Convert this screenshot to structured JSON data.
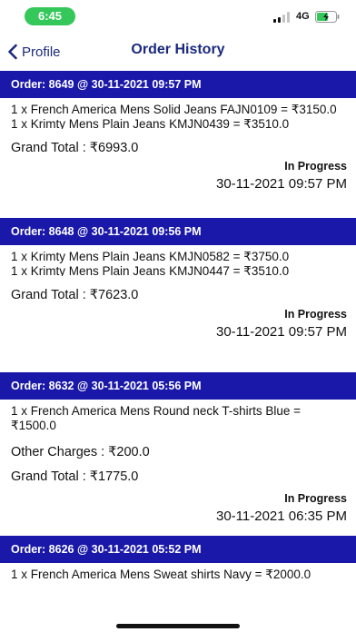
{
  "status_bar": {
    "time": "6:45",
    "network": "4G",
    "colors": {
      "time_pill": "#34c759"
    }
  },
  "nav": {
    "back_label": "Profile",
    "title": "Order History"
  },
  "colors": {
    "header_bg": "#1a18a8",
    "accent": "#1b2a7c"
  },
  "orders": [
    {
      "header": "Order: 8649 @ 30-11-2021 09:57 PM",
      "items": [
        "1 x French America Mens Solid Jeans FAJN0109 = ₹3150.0",
        "1 x Krimty Mens Plain Jeans KMJN0439 = ₹3510.0"
      ],
      "grand_total": "Grand Total : ₹6993.0",
      "status": "In Progress",
      "date": "30-11-2021 09:57 PM"
    },
    {
      "header": "Order: 8648 @ 30-11-2021 09:56 PM",
      "items": [
        "1 x Krimty Mens Plain Jeans KMJN0582 = ₹3750.0",
        "1 x Krimty Mens Plain Jeans KMJN0447 = ₹3510.0"
      ],
      "grand_total": "Grand Total : ₹7623.0",
      "status": "In Progress",
      "date": "30-11-2021 09:57 PM"
    },
    {
      "header": "Order: 8632 @ 30-11-2021 05:56 PM",
      "items": [
        "1 x French America Mens Round neck T-shirts Blue = ₹1500.0"
      ],
      "other_charges": "Other Charges : ₹200.0",
      "grand_total": "Grand Total : ₹1775.0",
      "status": "In Progress",
      "date": "30-11-2021 06:35 PM"
    },
    {
      "header": "Order: 8626 @ 30-11-2021 05:52 PM",
      "items": [
        "1 x French America Mens Sweat shirts Navy = ₹2000.0"
      ]
    }
  ]
}
